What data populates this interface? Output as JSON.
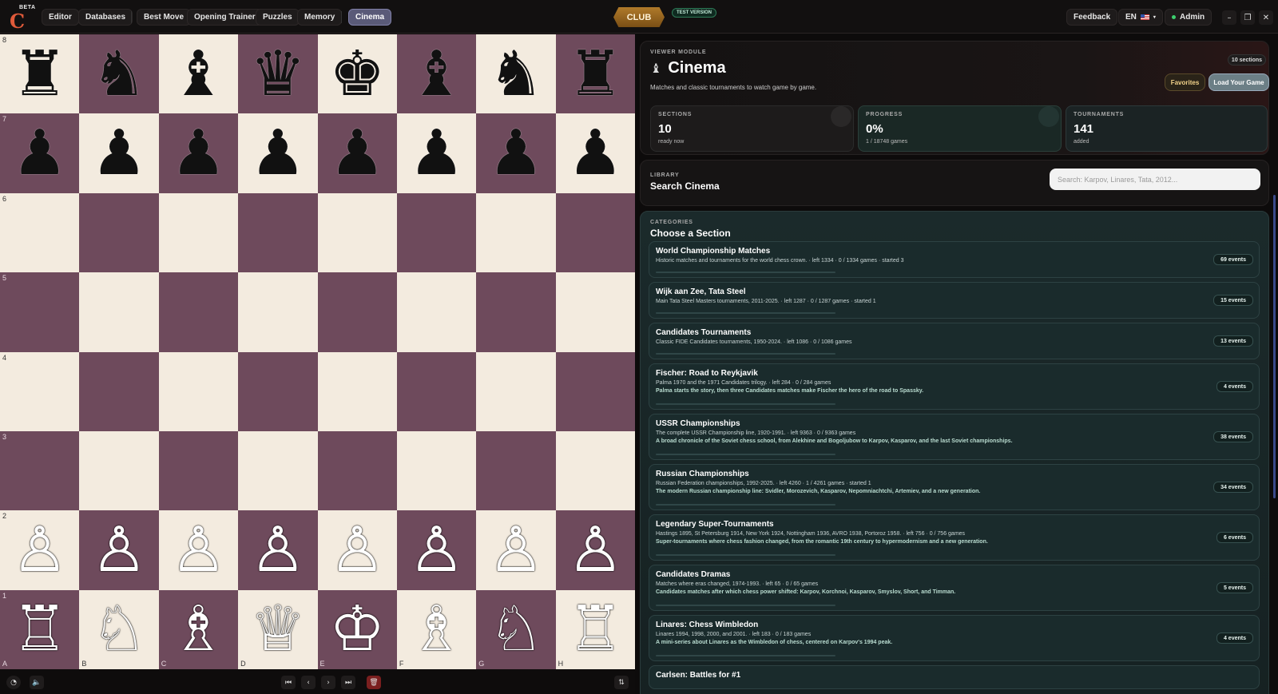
{
  "app": {
    "beta_label": "BETA",
    "logo_letter": "C"
  },
  "nav": [
    "Editor",
    "Databases",
    "Best Move",
    "Opening Trainer",
    "Puzzles",
    "Memory",
    "Cinema"
  ],
  "nav_active": "Cinema",
  "club_label": "CLUB",
  "test_version_label": "TEST VERSION",
  "header_right": {
    "feedback": "Feedback",
    "language": "EN",
    "admin": "Admin"
  },
  "window_controls": {
    "minimize": "–",
    "maximize": "❐",
    "close": "✕"
  },
  "board": {
    "ranks": [
      "8",
      "7",
      "6",
      "5",
      "4",
      "3",
      "2",
      "1"
    ],
    "files": [
      "A",
      "B",
      "C",
      "D",
      "E",
      "F",
      "G",
      "H"
    ],
    "position": [
      [
        "♜",
        "♞",
        "♝",
        "♛",
        "♚",
        "♝",
        "♞",
        "♜"
      ],
      [
        "♟",
        "♟",
        "♟",
        "♟",
        "♟",
        "♟",
        "♟",
        "♟"
      ],
      [
        "",
        "",
        "",
        "",
        "",
        "",
        "",
        ""
      ],
      [
        "",
        "",
        "",
        "",
        "",
        "",
        "",
        ""
      ],
      [
        "",
        "",
        "",
        "",
        "",
        "",
        "",
        ""
      ],
      [
        "",
        "",
        "",
        "",
        "",
        "",
        "",
        ""
      ],
      [
        "♙",
        "♙",
        "♙",
        "♙",
        "♙",
        "♙",
        "♙",
        "♙"
      ],
      [
        "♖",
        "♘",
        "♗",
        "♕",
        "♔",
        "♗",
        "♘",
        "♖"
      ]
    ],
    "colors": {
      "light": "#f3ebdf",
      "dark": "#6e4a5c"
    }
  },
  "board_controls": {
    "first": "⏮",
    "prev": "‹",
    "next": "›",
    "last": "⏭",
    "delete": "🗑",
    "flip": "⇅"
  },
  "viewer": {
    "eyebrow": "VIEWER MODULE",
    "title": "Cinema",
    "subtitle": "Matches and classic tournaments to watch game by game.",
    "sections_badge": "10 sections",
    "favorites": "Favorites",
    "load_game": "Load Your Game",
    "stats": [
      {
        "label": "SECTIONS",
        "value": "10",
        "sub": "ready now"
      },
      {
        "label": "PROGRESS",
        "value": "0%",
        "sub": "1 / 18748 games"
      },
      {
        "label": "TOURNAMENTS",
        "value": "141",
        "sub": "added"
      }
    ]
  },
  "library": {
    "eyebrow": "LIBRARY",
    "title": "Search Cinema",
    "search_placeholder": "Search: Karpov, Linares, Tata, 2012..."
  },
  "categories": {
    "eyebrow": "CATEGORIES",
    "title": "Choose a Section",
    "items": [
      {
        "title": "World Championship Matches",
        "desc": "Historic matches and tournaments for the world chess crown. · left 1334 · 0 / 1334 games · started 3",
        "desc2": "",
        "events": "69 events"
      },
      {
        "title": "Wijk aan Zee, Tata Steel",
        "desc": "Main Tata Steel Masters tournaments, 2011-2025. · left 1287 · 0 / 1287 games · started 1",
        "desc2": "",
        "events": "15 events"
      },
      {
        "title": "Candidates Tournaments",
        "desc": "Classic FIDE Candidates tournaments, 1950-2024. · left 1086 · 0 / 1086 games",
        "desc2": "",
        "events": "13 events"
      },
      {
        "title": "Fischer: Road to Reykjavik",
        "desc": "Palma 1970 and the 1971 Candidates trilogy. · left 284 · 0 / 284 games",
        "desc2": "Palma starts the story, then three Candidates matches make Fischer the hero of the road to Spassky.",
        "events": "4 events"
      },
      {
        "title": "USSR Championships",
        "desc": "The complete USSR Championship line, 1920-1991. · left 9363 · 0 / 9363 games",
        "desc2": "A broad chronicle of the Soviet chess school, from Alekhine and Bogoljubow to Karpov, Kasparov, and the last Soviet championships.",
        "events": "38 events"
      },
      {
        "title": "Russian Championships",
        "desc": "Russian Federation championships, 1992-2025. · left 4260 · 1 / 4261 games · started 1",
        "desc2": "The modern Russian championship line: Svidler, Morozevich, Kasparov, Nepomniachtchi, Artemiev, and a new generation.",
        "events": "34 events"
      },
      {
        "title": "Legendary Super-Tournaments",
        "desc": "Hastings 1895, St Petersburg 1914, New York 1924, Nottingham 1936, AVRO 1938, Portoroz 1958. · left 756 · 0 / 756 games",
        "desc2": "Super-tournaments where chess fashion changed, from the romantic 19th century to hypermodernism and a new generation.",
        "events": "6 events"
      },
      {
        "title": "Candidates Dramas",
        "desc": "Matches where eras changed, 1974-1993. · left 65 · 0 / 65 games",
        "desc2": "Candidates matches after which chess power shifted: Karpov, Korchnoi, Kasparov, Smyslov, Short, and Timman.",
        "events": "5 events"
      },
      {
        "title": "Linares: Chess Wimbledon",
        "desc": "Linares 1994, 1998, 2000, and 2001. · left 183 · 0 / 183 games",
        "desc2": "A mini-series about Linares as the Wimbledon of chess, centered on Karpov's 1994 peak.",
        "events": "4 events"
      },
      {
        "title": "Carlsen: Battles for #1",
        "desc": "",
        "desc2": "",
        "events": ""
      }
    ]
  }
}
